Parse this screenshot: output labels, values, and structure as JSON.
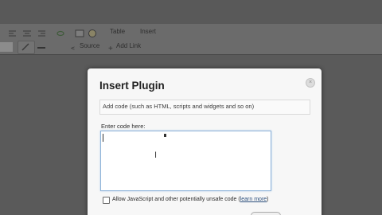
{
  "toolbar": {
    "table_label": "Table",
    "insert_label": "Insert",
    "source_label": "Source",
    "add_link_label": "Add Link"
  },
  "dialog": {
    "title": "Insert Plugin",
    "close_glyph": "×",
    "description": "Add code (such as HTML, scripts and widgets and so on)",
    "code_label": "Enter code here:",
    "code_value": "",
    "checkbox_label": "Allow JavaScript and other potentially unsafe code (",
    "learn_more": "learn more",
    "checkbox_suffix": ")",
    "checkbox_checked": false
  },
  "colors": {
    "overlay": "#525252",
    "dialog_bg": "#f7f7f7",
    "focus_border": "#8fb4d9",
    "link": "#2b4f7c"
  }
}
